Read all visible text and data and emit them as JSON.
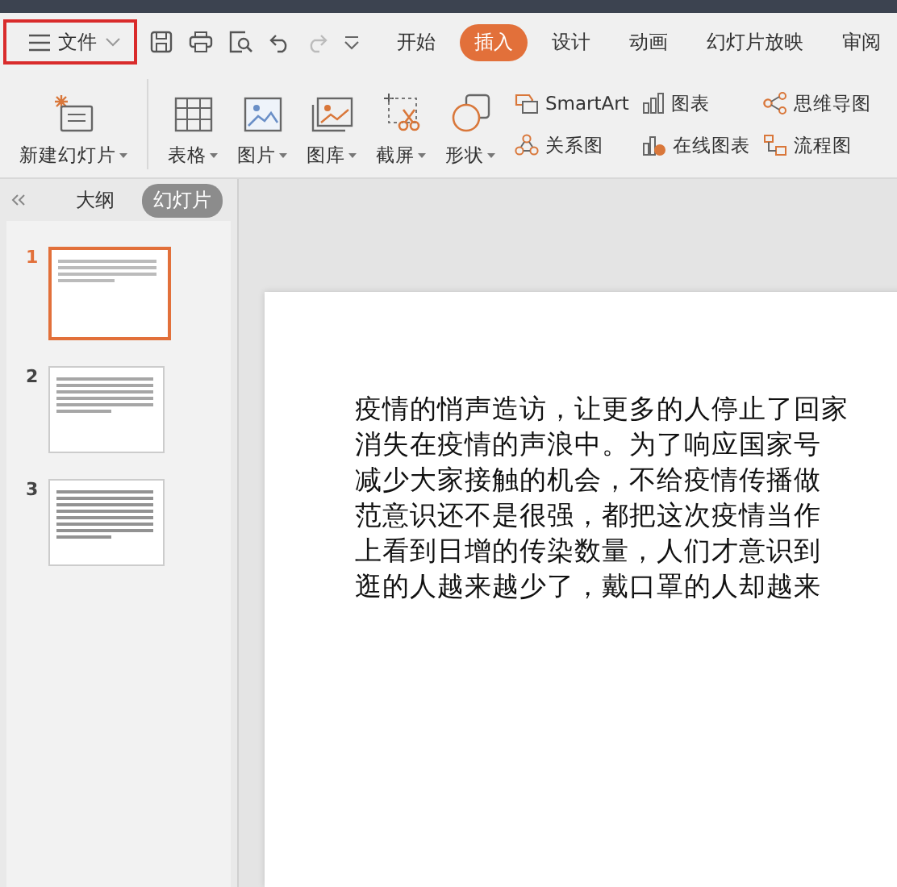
{
  "quick_bar": {
    "file_menu": "文件",
    "tabs": [
      {
        "label": "开始",
        "selected": false
      },
      {
        "label": "插入",
        "selected": true
      },
      {
        "label": "设计",
        "selected": false
      },
      {
        "label": "动画",
        "selected": false
      },
      {
        "label": "幻灯片放映",
        "selected": false
      },
      {
        "label": "审阅",
        "selected": false
      }
    ]
  },
  "ribbon": {
    "large_items": [
      {
        "label": "新建幻灯片",
        "kind": "new-slide"
      },
      {
        "label": "表格",
        "kind": "table"
      },
      {
        "label": "图片",
        "kind": "picture"
      },
      {
        "label": "图库",
        "kind": "gallery"
      },
      {
        "label": "截屏",
        "kind": "screenshot"
      },
      {
        "label": "形状",
        "kind": "shape"
      }
    ],
    "small_columns": [
      [
        {
          "label": "SmartArt",
          "kind": "smartart"
        },
        {
          "label": "关系图",
          "kind": "relation"
        }
      ],
      [
        {
          "label": "图表",
          "kind": "chart"
        },
        {
          "label": "在线图表",
          "kind": "online-chart"
        }
      ],
      [
        {
          "label": "思维导图",
          "kind": "mindmap"
        },
        {
          "label": "流程图",
          "kind": "flowchart"
        }
      ]
    ]
  },
  "sidebar": {
    "tabs": [
      {
        "label": "大纲",
        "selected": false
      },
      {
        "label": "幻灯片",
        "selected": true
      }
    ],
    "slides": [
      {
        "number": "1",
        "selected": true
      },
      {
        "number": "2",
        "selected": false
      },
      {
        "number": "3",
        "selected": false
      }
    ]
  },
  "slide": {
    "lines": [
      "疫情的悄声造访，让更多的人停止了回家",
      "消失在疫情的声浪中。为了响应国家号",
      "减少大家接触的机会，不给疫情传播做",
      "范意识还不是很强，都把这次疫情当作",
      "上看到日增的传染数量，人们才意识到",
      "逛的人越来越少了，戴口罩的人却越来"
    ]
  }
}
